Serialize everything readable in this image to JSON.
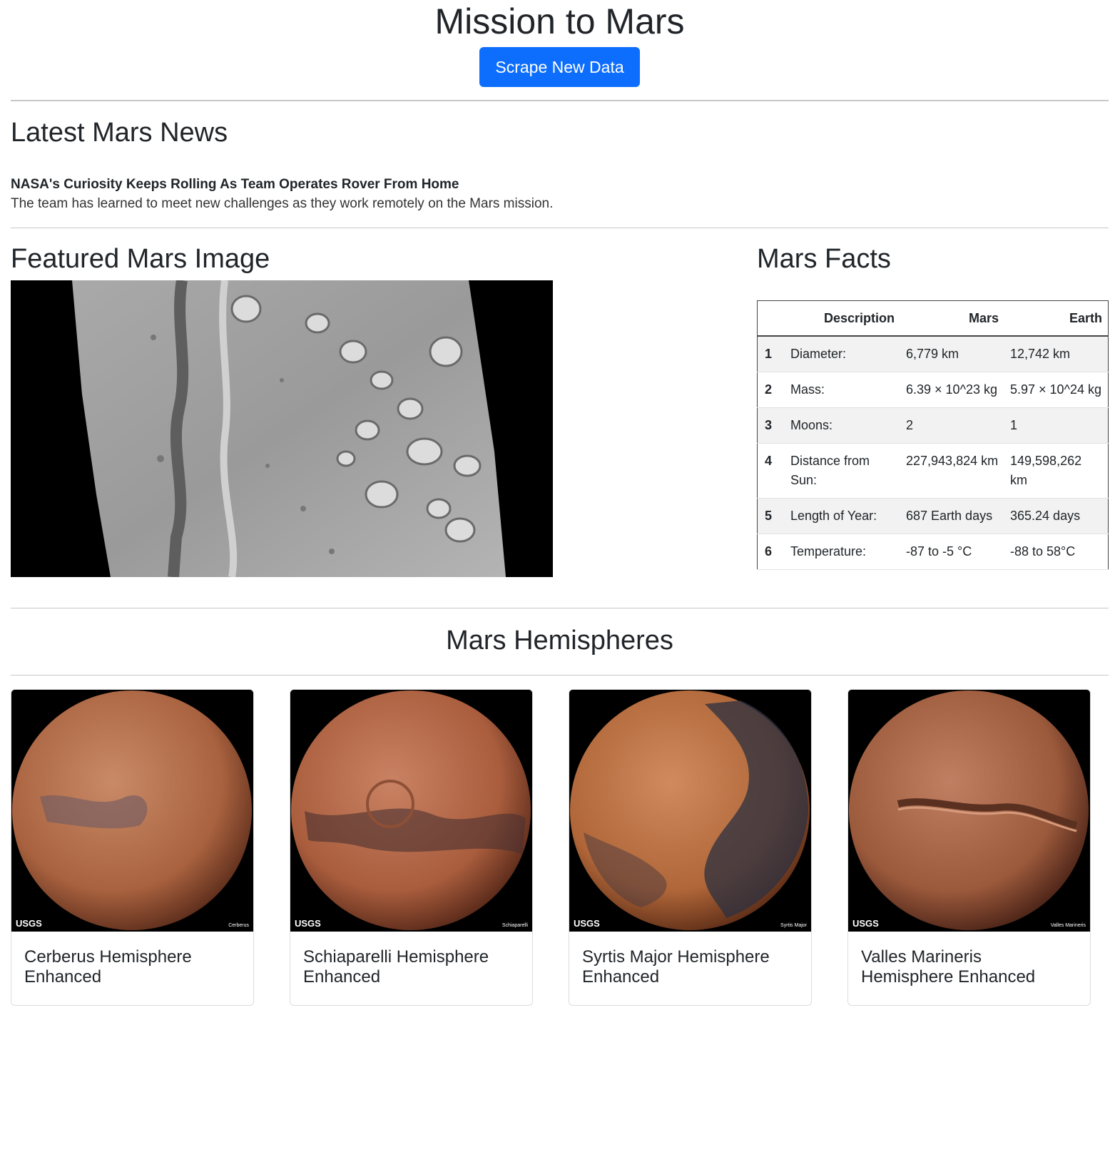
{
  "header": {
    "title": "Mission to Mars",
    "scrape_button": "Scrape New Data"
  },
  "news": {
    "heading": "Latest Mars News",
    "title": "NASA's Curiosity Keeps Rolling As Team Operates Rover From Home",
    "teaser": "The team has learned to meet new challenges as they work remotely on the Mars mission."
  },
  "featured": {
    "heading": "Featured Mars Image"
  },
  "facts": {
    "heading": "Mars Facts",
    "columns": [
      "Description",
      "Mars",
      "Earth"
    ],
    "rows": [
      {
        "idx": "1",
        "desc": "Diameter:",
        "mars": "6,779 km",
        "earth": "12,742 km"
      },
      {
        "idx": "2",
        "desc": "Mass:",
        "mars": "6.39 × 10^23 kg",
        "earth": "5.97 × 10^24 kg"
      },
      {
        "idx": "3",
        "desc": "Moons:",
        "mars": "2",
        "earth": "1"
      },
      {
        "idx": "4",
        "desc": "Distance from Sun:",
        "mars": "227,943,824 km",
        "earth": "149,598,262 km"
      },
      {
        "idx": "5",
        "desc": "Length of Year:",
        "mars": "687 Earth days",
        "earth": "365.24 days"
      },
      {
        "idx": "6",
        "desc": "Temperature:",
        "mars": "-87 to -5 °C",
        "earth": "-88 to 58°C"
      }
    ]
  },
  "hemispheres": {
    "heading": "Mars Hemispheres",
    "items": [
      {
        "name": "Cerberus Hemisphere Enhanced",
        "watermark": "USGS",
        "label": "Cerberus"
      },
      {
        "name": "Schiaparelli Hemisphere Enhanced",
        "watermark": "USGS",
        "label": "Schiaparelli"
      },
      {
        "name": "Syrtis Major Hemisphere Enhanced",
        "watermark": "USGS",
        "label": "Syrtis Major"
      },
      {
        "name": "Valles Marineris Hemisphere Enhanced",
        "watermark": "USGS",
        "label": "Valles Marineris"
      }
    ]
  },
  "colors": {
    "primary_button": "#0d6efd",
    "mars_base": "#b5653f",
    "mars_dark": "#4a3030"
  }
}
